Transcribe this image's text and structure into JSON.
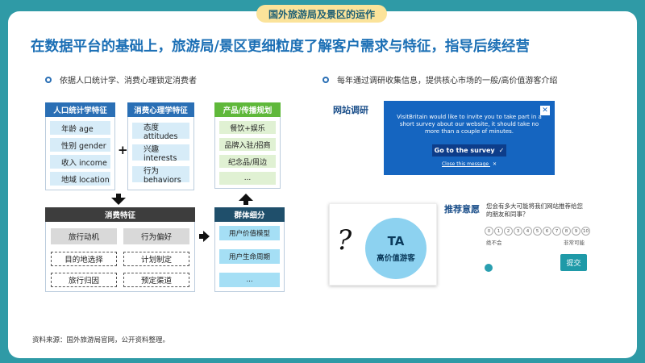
{
  "header": {
    "tag": "国外旅游局及景区的运作"
  },
  "title": "在数据平台的基础上，旅游局/景区更细粒度了解客户需求与特征，指导后续经营",
  "left": {
    "bullet": "依据人口统计学、消费心理锁定消费者",
    "demographics": {
      "title": "人口统计学特征",
      "items": [
        "年龄 age",
        "性别 gender",
        "收入 income",
        "地域 location"
      ]
    },
    "plus": "+",
    "psychology": {
      "title": "消费心理学特征",
      "items": [
        "态度 attitudes",
        "兴趣 interests",
        "行为 behaviors"
      ]
    },
    "products": {
      "title": "产品/传播规划",
      "items": [
        "餐饮+娱乐",
        "品牌入驻/招商",
        "纪念品/周边",
        "..."
      ]
    },
    "consumption": {
      "title": "消费特征",
      "items": [
        "旅行动机",
        "行为偏好",
        "目的地选择",
        "计划制定",
        "旅行归因",
        "预定渠道"
      ]
    },
    "segmentation": {
      "title": "群体细分",
      "items": [
        "用户价值模型",
        "用户生命周期",
        "..."
      ]
    }
  },
  "right": {
    "bullet": "每年通过调研收集信息，提供核心市场的一般/高价值游客介绍",
    "website_label": "网站调研",
    "survey": {
      "close": "✕",
      "text": "VisitBritain would like to invite you to take part in a short survey about our website, it should take no more than a couple of minutes.",
      "button": "Go to the survey",
      "close_link": "Close this message"
    },
    "ta": {
      "question_mark": "?",
      "label": "TA",
      "sublabel": "高价值游客"
    },
    "recommend": {
      "label": "推荐意愿",
      "question": "您会有多大可能将我们网站推荐给您的朋友和同事？",
      "scale": [
        "0",
        "1",
        "2",
        "3",
        "4",
        "5",
        "6",
        "7",
        "8",
        "9",
        "10"
      ],
      "low": "绝不会",
      "high": "非常可能",
      "submit": "提交"
    }
  },
  "footer": {
    "source": "资料来源：国外旅游局官网，公开资料整理。"
  },
  "colors": {
    "background": "#2f9aa6",
    "accent": "#1b6fb5",
    "tag": "#fbe39a",
    "survey": "#1565c0"
  }
}
